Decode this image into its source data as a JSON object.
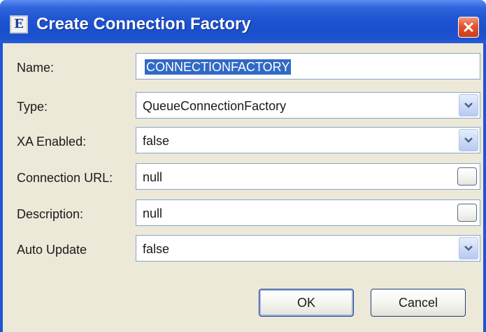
{
  "window": {
    "title": "Create Connection Factory",
    "app_icon_letter": "E"
  },
  "form": {
    "rows": [
      {
        "label": "Name:",
        "value": "CONNECTIONFACTORY",
        "control": "text",
        "selected": true
      },
      {
        "label": "Type:",
        "value": "QueueConnectionFactory",
        "control": "dropdown"
      },
      {
        "label": "XA Enabled:",
        "value": "false",
        "control": "dropdown"
      },
      {
        "label": "Connection URL:",
        "value": "null",
        "control": "ellipsis"
      },
      {
        "label": "Description:",
        "value": "null",
        "control": "ellipsis"
      },
      {
        "label": "Auto Update",
        "value": "false",
        "control": "dropdown"
      }
    ]
  },
  "buttons": {
    "ok_label": "OK",
    "cancel_label": "Cancel"
  },
  "colors": {
    "titlebar": "#1f54d2",
    "dialog_bg": "#ece9d8",
    "selection": "#316ac5",
    "close_button": "#e0552f"
  },
  "icons": {
    "close": "close-icon",
    "dropdown": "chevron-down-icon",
    "app": "app-icon"
  }
}
